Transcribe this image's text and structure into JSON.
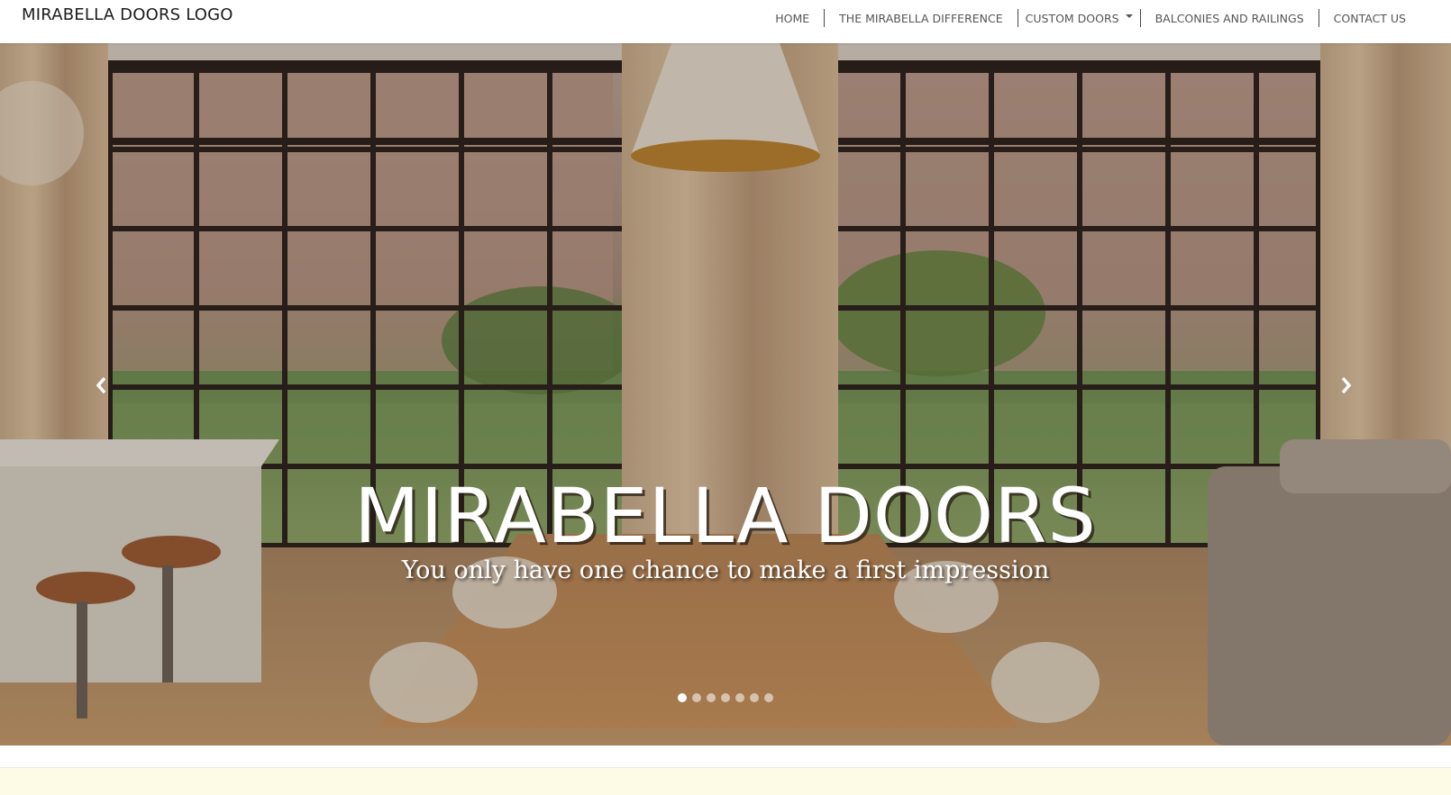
{
  "navbar": {
    "brand": "MIRABELLA DOORS LOGO",
    "items": [
      {
        "label": "HOME"
      },
      {
        "label": "THE MIRABELLA DIFFERENCE"
      },
      {
        "label": "CUSTOM DOORS",
        "has_dropdown": true
      },
      {
        "label": "BALCONIES AND RAILINGS"
      },
      {
        "label": "CONTACT US"
      }
    ]
  },
  "hero": {
    "title": "MIRABELLA DOORS",
    "subtitle": "You only have one chance to make a first impression",
    "slide_count": 7,
    "active_slide": 1,
    "prev_icon": "chevron-left-icon",
    "next_icon": "chevron-right-icon"
  },
  "colors": {
    "nav_text": "#555555",
    "strip": "#fdfbe5"
  }
}
